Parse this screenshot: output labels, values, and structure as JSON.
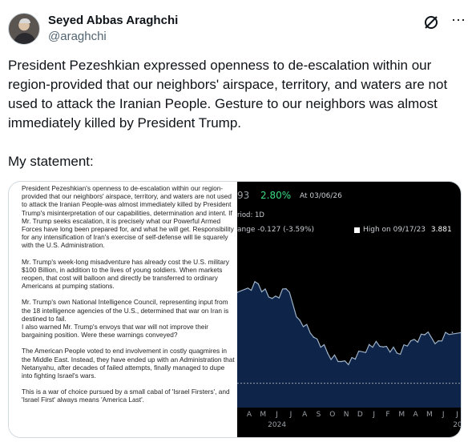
{
  "author": {
    "display_name": "Seyed Abbas Araghchi",
    "handle": "@araghchi"
  },
  "icons": {
    "grok": "grok-icon",
    "more": "more-icon"
  },
  "tweet": {
    "text": "President Pezeshkian expressed openness to de-escalation within our region-provided that our neighbors' airspace, territory, and waters are not used to attack the Iranian People. Gesture to our neighbors was almost immediately killed by President Trump.\n\nMy statement:"
  },
  "statement": {
    "paragraphs": [
      "President Pezeshkian's openness to de-escalation within our region-provided that our neighbors' airspace, territory, and waters are not used to attack the Iranian People-was almost immediately killed by President Trump's misinterpretation of our capabilities, determination and intent. If Mr. Trump seeks escalation, it is precisely what our Powerful Armed Forces have long been prepared for, and what he will get. Responsibility for any intensification of Iran's exercise of self-defense will lie squarely with the U.S. Administration.",
      "Mr. Trump's week-long misadventure has already cost the U.S. military $100 Billion, in addition to the lives of young soldiers. When markets reopen, that cost will balloon and directly be transferred to ordinary Americans at pumping stations.",
      "Mr. Trump's own National Intelligence Council, representing input from the 18 intelligence agencies of the U.S., determined that war on Iran is destined to fail.\nI also warned Mr. Trump's envoys that war will not improve their bargaining position. Were these warnings conveyed?",
      "The American People voted to end involvement in costly quagmires in the Middle East. Instead, they have ended up with an Administration that Netanyahu, after decades of failed attempts, finally managed to dupe into fighting Israel's wars.",
      "This is a war of choice pursued by a small cabal of 'Israel Firsters', and 'Israel First' always means 'America Last'."
    ]
  },
  "chart_panel": {
    "price_fragment": "93",
    "change_pct": "2.80%",
    "as_of": "At 03/06/26",
    "period": "riod: 1D",
    "change": "ange  -0.127 (-3.59%)",
    "high_label": "High on 09/17/23",
    "high_value": "3.881",
    "colors": {
      "background": "#000000",
      "line": "#9fb3c8",
      "fill": "#0e2448",
      "positive": "#3ddc84"
    }
  },
  "chart_data": {
    "type": "area",
    "x": [
      "Apr 2024",
      "May 2024",
      "Jun 2024",
      "Jul 2024",
      "Aug 2024",
      "Sep 2024",
      "Oct 2024",
      "Nov 2024",
      "Dec 2024",
      "Jan 2025",
      "Feb 2025",
      "Mar 2025",
      "Apr 2025",
      "May 2025",
      "Jun 2025",
      "Jul 2025"
    ],
    "values": [
      3.45,
      3.52,
      3.4,
      3.48,
      3.22,
      3.08,
      2.95,
      2.88,
      2.9,
      3.02,
      3.0,
      2.95,
      3.05,
      3.1,
      3.05,
      3.12
    ],
    "x_ticks": [
      "A",
      "M",
      "J",
      "J",
      "A",
      "S",
      "O",
      "N",
      "D",
      "J",
      "F",
      "M",
      "A",
      "M",
      "J",
      "J"
    ],
    "x_year_labels": [
      "2024",
      "20"
    ],
    "ylim": [
      2.5,
      3.9
    ],
    "reference_line_value": 2.7,
    "grid": false,
    "legend": "none"
  }
}
